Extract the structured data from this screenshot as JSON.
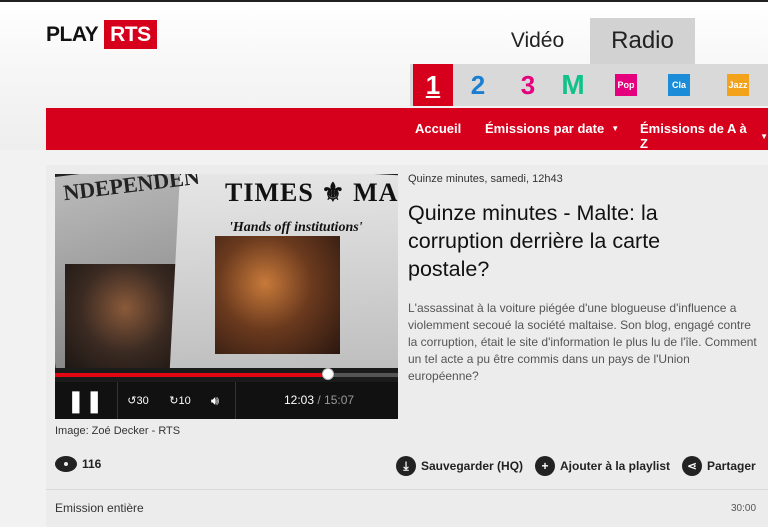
{
  "brand": {
    "play": "PLAY",
    "rts": "RTS",
    "accent": "#d6001c"
  },
  "media_tabs": [
    {
      "label": "Vidéo",
      "selected": false
    },
    {
      "label": "Radio",
      "selected": true
    }
  ],
  "channels": [
    {
      "label": "1",
      "color": "#d6001c",
      "selected": true
    },
    {
      "label": "2",
      "color": "#1a7fd1"
    },
    {
      "label": "3",
      "color": "#e5007d"
    },
    {
      "label": "M",
      "color": "#10c28a"
    },
    {
      "label": "Pop",
      "icon": "rts-pop-icon",
      "color": "#e5007d"
    },
    {
      "label": "Cla",
      "icon": "rts-classique-icon",
      "color": "#1b8dd8"
    },
    {
      "label": "Jazz",
      "icon": "rts-jazz-icon",
      "color": "#f3a21b"
    }
  ],
  "nav": {
    "accueil": "Accueil",
    "by_date": "Émissions par date",
    "a_to_z": "Émissions de A à Z",
    "caret": "▼"
  },
  "episode": {
    "meta": "Quinze minutes, samedi, 12h43",
    "title": "Quinze minutes - Malte: la corruption derrière la carte postale?",
    "description": "L'assassinat à la voiture piégée d'une blogueuse d'influence a violemment secoué la société maltaise. Son blog, engagé contre la corruption, était le site d'information le plus lu de l'île. Comment un tel acte a pu être commis dans un pays de l'Union européenne?",
    "image_credit": "Image: Zoé Decker - RTS"
  },
  "thumbnail_text": {
    "masthead": "TIMES ⚜ MALTA",
    "masthead2": "NDEPENDEN",
    "headline": "'Hands off institutions'"
  },
  "player": {
    "current_time": "12:03",
    "separator": " / ",
    "total_time": "15:07",
    "progress": 0.797,
    "skip_back": "30",
    "skip_fwd": "10"
  },
  "actions": {
    "views": "116",
    "save": "Sauvegarder (HQ)",
    "add_playlist": "Ajouter à la playlist",
    "share": "Partager"
  },
  "segment": {
    "label": "Emission entière",
    "duration": "30:00"
  }
}
